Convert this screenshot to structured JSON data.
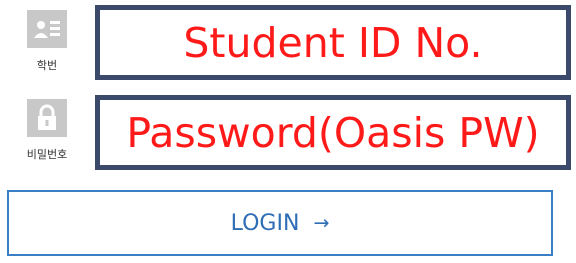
{
  "student_id": {
    "icon": "id-card-icon",
    "caption": "학번",
    "text": "Student ID No."
  },
  "password": {
    "icon": "lock-icon",
    "caption": "비밀번호",
    "text": "Password(Oasis PW)"
  },
  "login": {
    "label": "LOGIN",
    "arrow": "→"
  },
  "colors": {
    "field_border": "#3b4a6b",
    "field_text": "#ff1a1a",
    "icon_bg": "#c8c8c8",
    "button_border": "#3a7fc4",
    "button_text": "#2f6db5"
  }
}
